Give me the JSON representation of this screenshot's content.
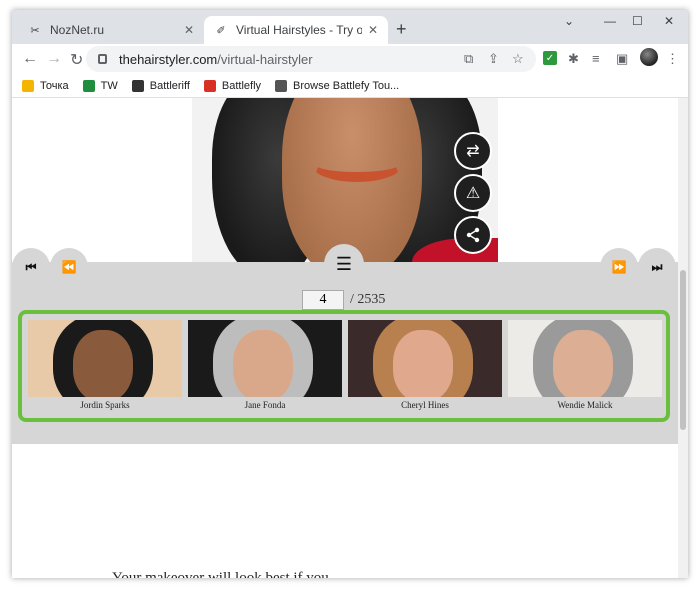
{
  "tabs": [
    {
      "title": "NozNet.ru",
      "active": false
    },
    {
      "title": "Virtual Hairstyles - Try on Hairstyles",
      "active": true
    }
  ],
  "address": {
    "host": "thehairstyler.com",
    "path": "/virtual-hairstyler"
  },
  "bookmarks": [
    {
      "label": "Точка",
      "color": "#f4b400"
    },
    {
      "label": "TW",
      "color": "#1e8e3e"
    },
    {
      "label": "Battleriff",
      "color": "#333333"
    },
    {
      "label": "Battlefly",
      "color": "#d93025"
    },
    {
      "label": "Browse Battlefy Tou...",
      "color": "#555555"
    }
  ],
  "pager": {
    "current": "4",
    "total": "/ 2535"
  },
  "thumbnails": [
    {
      "name": "Jordin Sparks",
      "hair": "#1a1a1a",
      "skin": "#8a5a3c",
      "bg": "#e8c9a8"
    },
    {
      "name": "Jane Fonda",
      "hair": "#bdbdbd",
      "skin": "#d9a88a",
      "bg": "#1a1a1a"
    },
    {
      "name": "Cheryl Hines",
      "hair": "#b9804f",
      "skin": "#e0a88c",
      "bg": "#3a2a2a"
    },
    {
      "name": "Wendie Malick",
      "hair": "#9a9a9a",
      "skin": "#dcae94",
      "bg": "#ecebe8"
    }
  ],
  "below_text": "Your makeover will look best if you",
  "icons": {
    "swap": "⇄",
    "warning": "⚠",
    "share": "share",
    "first": "first",
    "prev": "prev",
    "next": "next",
    "last": "last",
    "menu": "☰"
  }
}
